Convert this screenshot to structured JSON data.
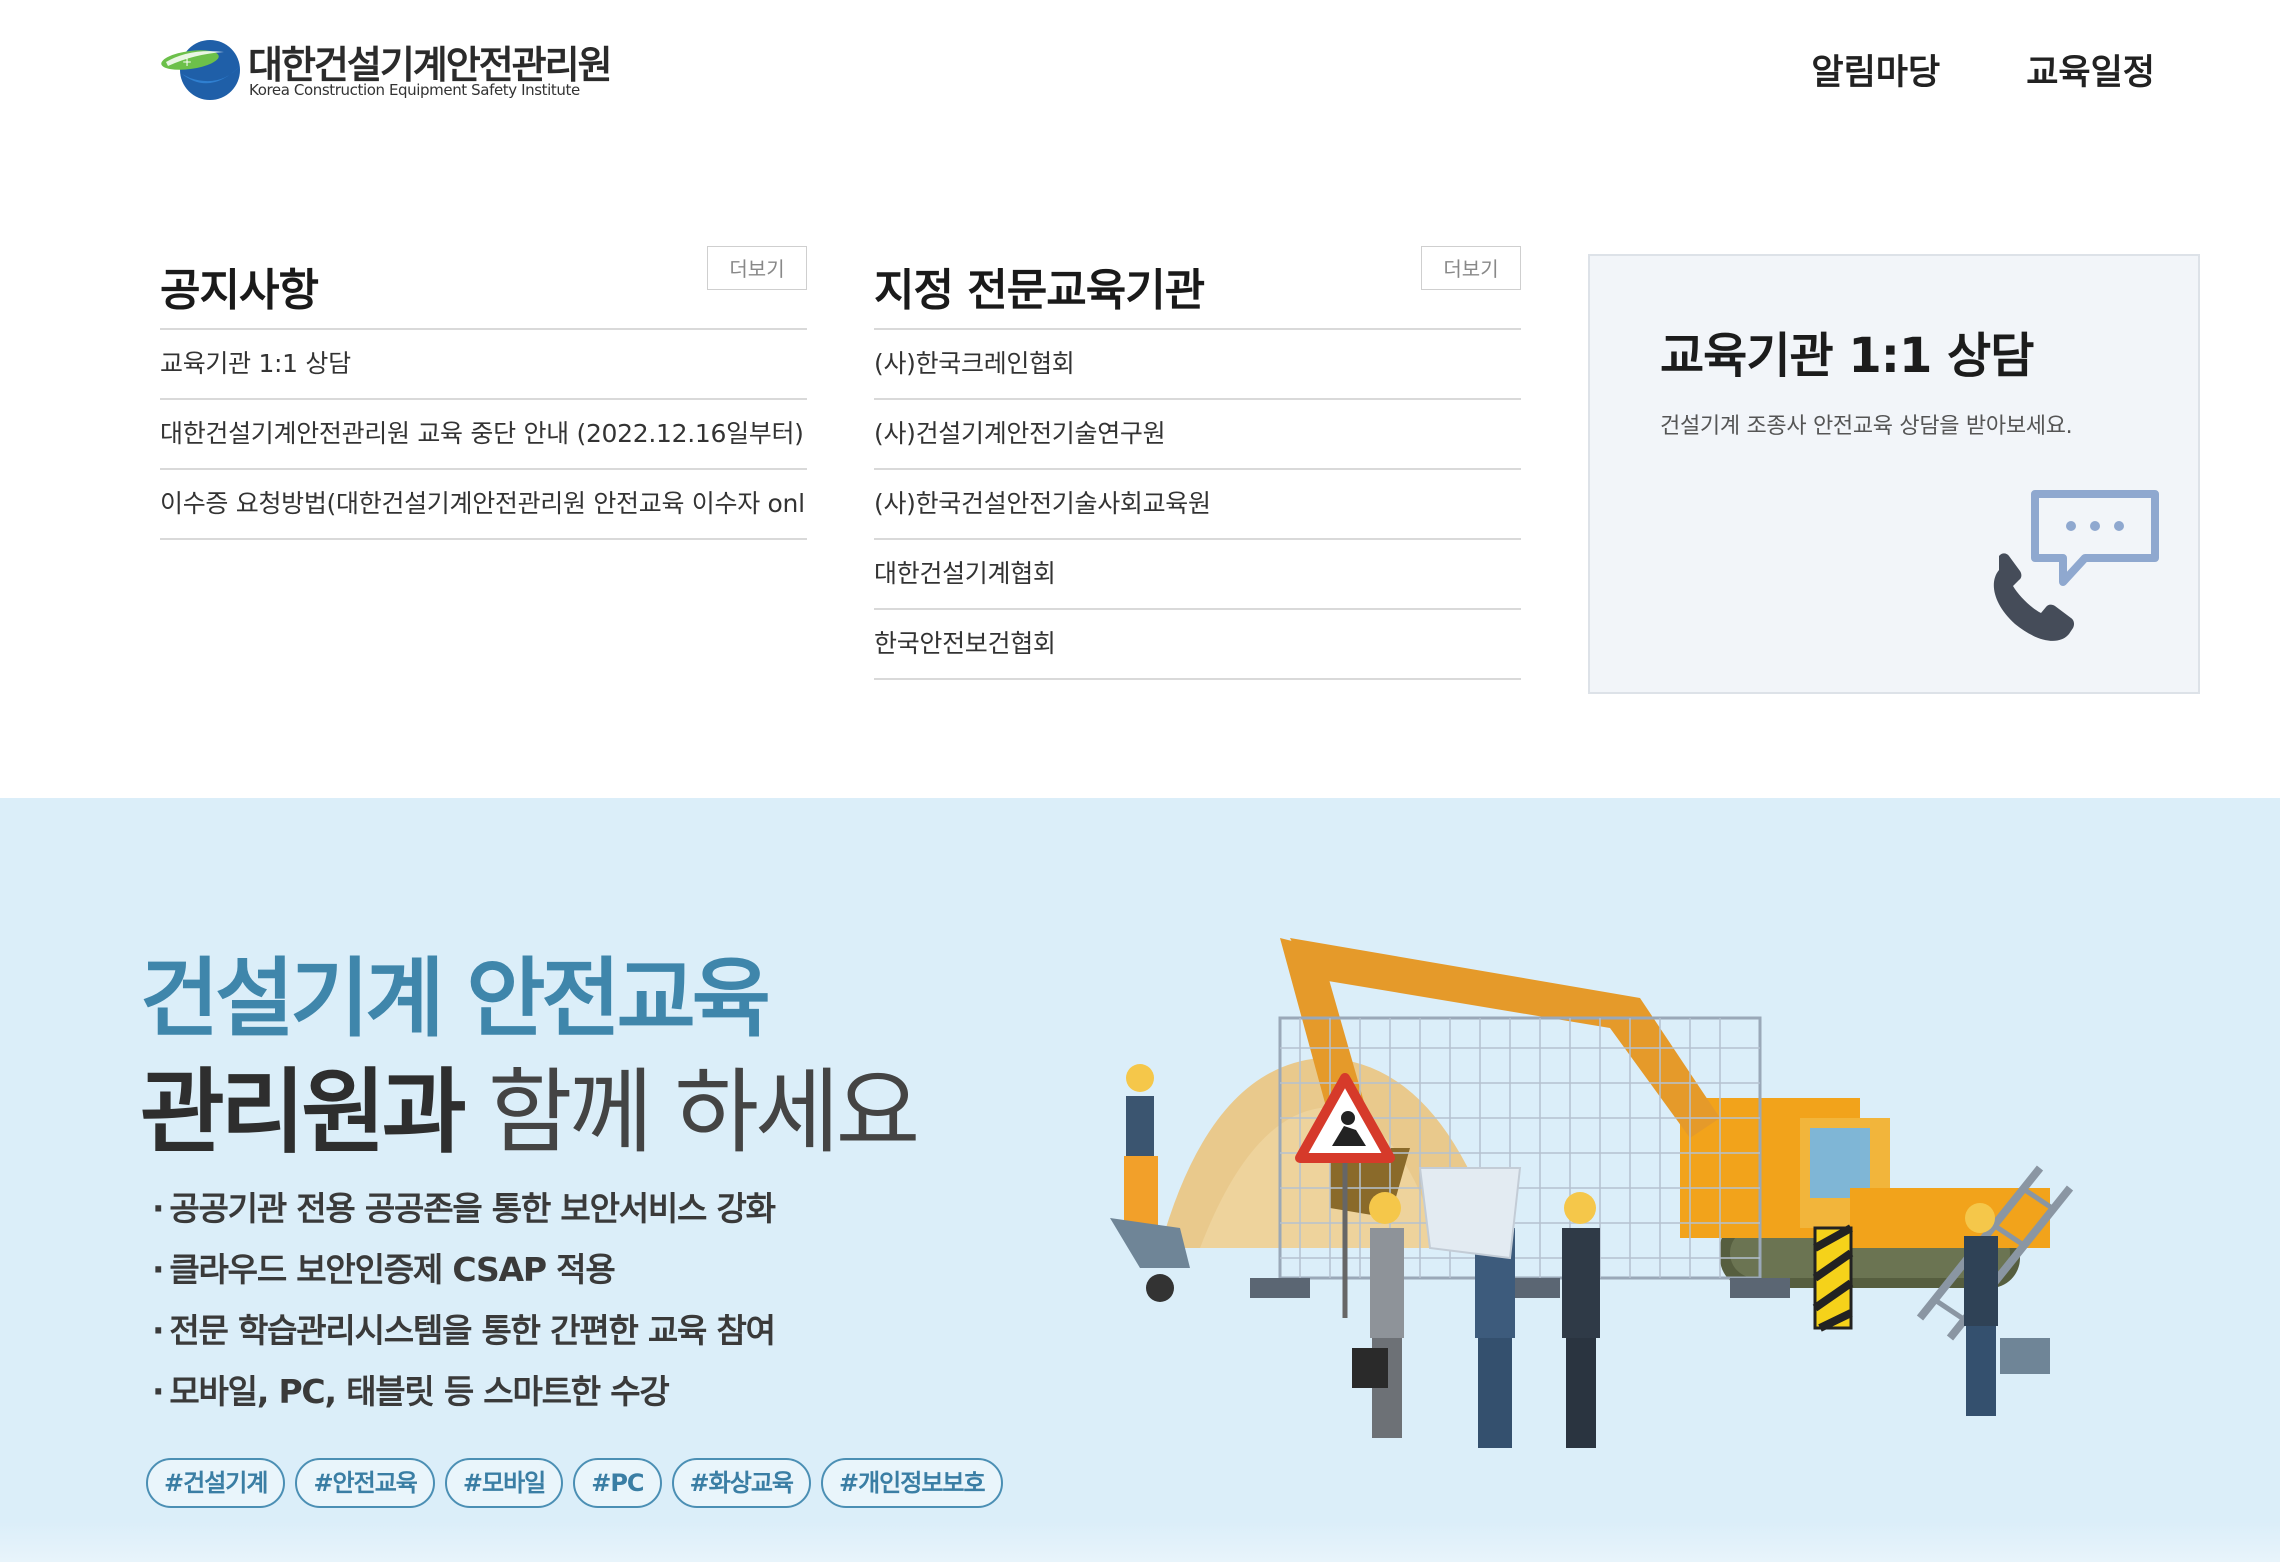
{
  "header": {
    "logo_kr": "대한건설기계안전관리원",
    "logo_en": "Korea Construction Equipment Safety Institute",
    "nav": [
      {
        "label": "알림마당"
      },
      {
        "label": "교육일정"
      }
    ]
  },
  "notice": {
    "title": "공지사항",
    "more_label": "더보기",
    "items": [
      "교육기관 1:1 상담",
      "대한건설기계안전관리원 교육 중단 안내 (2022.12.16일부터)",
      "이수증 요청방법(대한건설기계안전관리원 안전교육 이수자 onl"
    ]
  },
  "institutions": {
    "title": "지정 전문교육기관",
    "more_label": "더보기",
    "items": [
      "(사)한국크레인협회",
      "(사)건설기계안전기술연구원",
      "(사)한국건설안전기술사회교육원",
      "대한건설기계협회",
      "한국안전보건협회"
    ]
  },
  "consult": {
    "title": "교육기관 1:1 상담",
    "description": "건설기계 조종사 안전교육 상담을 받아보세요.",
    "icon": "phone-chat-icon"
  },
  "banner": {
    "headline": "건설기계 안전교육",
    "subline_bold": "관리원과",
    "subline_light": "함께 하세요",
    "bullets": [
      "공공기관 전용 공공존을 통한 보안서비스 강화",
      "클라우드 보안인증제 CSAP 적용",
      "전문 학습관리시스템을 통한 간편한 교육 참여",
      "모바일, PC, 태블릿 등 스마트한 수강"
    ],
    "tags": [
      "#건설기계",
      "#안전교육",
      "#모바일",
      "#PC",
      "#화상교육",
      "#개인정보보호"
    ],
    "illustration": "construction-site-illustration"
  },
  "colors": {
    "banner_bg": "#dbeef9",
    "headline_blue": "#3f86ab",
    "tag_border": "#4b8fb4",
    "consult_bg": "#f2f5f9"
  }
}
